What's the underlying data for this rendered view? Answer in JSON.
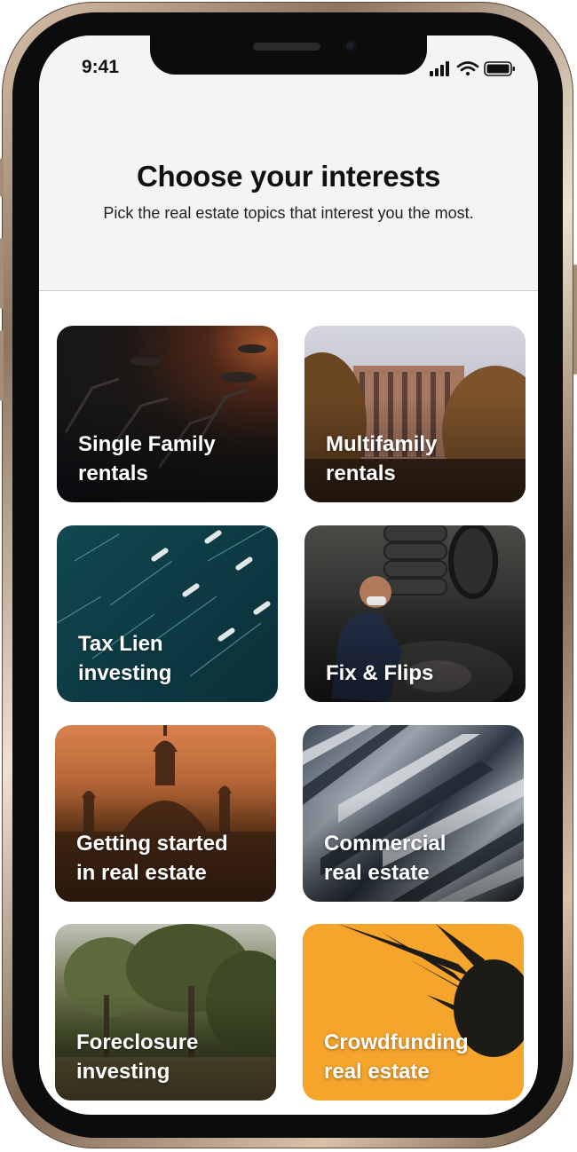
{
  "status_bar": {
    "time": "9:41"
  },
  "header": {
    "title": "Choose your interests",
    "subtitle": "Pick the real estate topics that interest you the most."
  },
  "cards": [
    {
      "label": "Single Family\nrentals",
      "image": "dark-cafe-chairs"
    },
    {
      "label": "Multifamily\nrentals",
      "image": "apartment-tower-trees"
    },
    {
      "label": "Tax Lien\ninvesting",
      "image": "teal-pattern"
    },
    {
      "label": "Fix & Flips",
      "image": "mechanic-tires"
    },
    {
      "label": "Getting started\nin real estate",
      "image": "domed-cathedral-sunset"
    },
    {
      "label": "Commercial\nreal estate",
      "image": "building-facade-lines"
    },
    {
      "label": "Foreclosure\ninvesting",
      "image": "forest-painting"
    },
    {
      "label": "Crowdfunding\nreal estate",
      "image": "pineapple-on-orange"
    }
  ],
  "colors": {
    "header_bg": "#f4f4f4",
    "crowdfunding_bg": "#f5a42c",
    "frame_gold": "#d9c3ab"
  },
  "icons": [
    "signal-icon",
    "wifi-icon",
    "battery-icon"
  ]
}
